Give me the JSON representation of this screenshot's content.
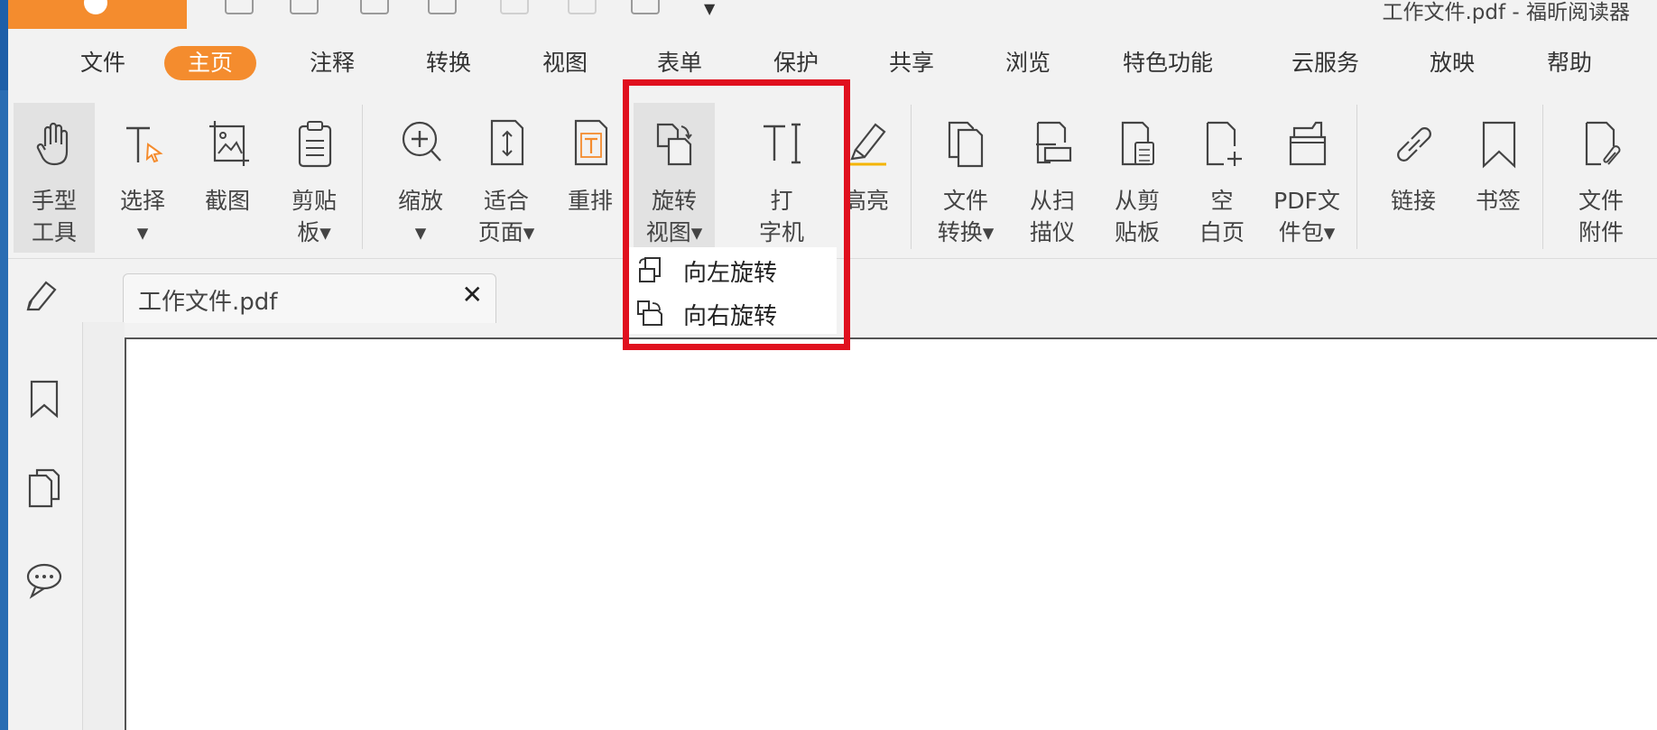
{
  "window": {
    "title": "工作文件.pdf - 福昕阅读器"
  },
  "menu": {
    "items": [
      "文件",
      "主页",
      "注释",
      "转换",
      "视图",
      "表单",
      "保护",
      "共享",
      "浏览",
      "特色功能",
      "云服务",
      "放映",
      "帮助"
    ],
    "active": "主页"
  },
  "ribbon": {
    "tools": [
      {
        "label": "手型\n工具",
        "icon": "hand-icon"
      },
      {
        "label": "选择\n▾",
        "icon": "select-text-icon"
      },
      {
        "label": "截图",
        "icon": "screenshot-icon"
      },
      {
        "label": "剪贴\n板▾",
        "icon": "clipboard-icon"
      },
      {
        "label": "缩放\n▾",
        "icon": "zoom-icon"
      },
      {
        "label": "适合\n页面▾",
        "icon": "fit-page-icon"
      },
      {
        "label": "重排",
        "icon": "reflow-icon"
      },
      {
        "label": "旋转\n视图▾",
        "icon": "rotate-view-icon"
      },
      {
        "label": "打\n字机",
        "icon": "typewriter-icon"
      },
      {
        "label": "高亮",
        "icon": "highlight-icon"
      },
      {
        "label": "文件\n转换▾",
        "icon": "file-convert-icon"
      },
      {
        "label": "从扫\n描仪",
        "icon": "scanner-icon"
      },
      {
        "label": "从剪\n贴板",
        "icon": "from-clipboard-icon"
      },
      {
        "label": "空\n白页",
        "icon": "blank-page-icon"
      },
      {
        "label": "PDF文\n件包▾",
        "icon": "pdf-package-icon"
      },
      {
        "label": "链接",
        "icon": "link-icon"
      },
      {
        "label": "书签",
        "icon": "bookmark-icon"
      },
      {
        "label": "文件\n附件",
        "icon": "attachment-icon"
      }
    ]
  },
  "rotate_menu": {
    "items": [
      {
        "label": "向左旋转",
        "icon": "rotate-left-icon"
      },
      {
        "label": "向右旋转",
        "icon": "rotate-right-icon"
      }
    ]
  },
  "document": {
    "tab_title": "工作文件.pdf",
    "close_label": "✕"
  },
  "colors": {
    "accent": "#f48c2e",
    "highlight_box": "#e0101e"
  }
}
